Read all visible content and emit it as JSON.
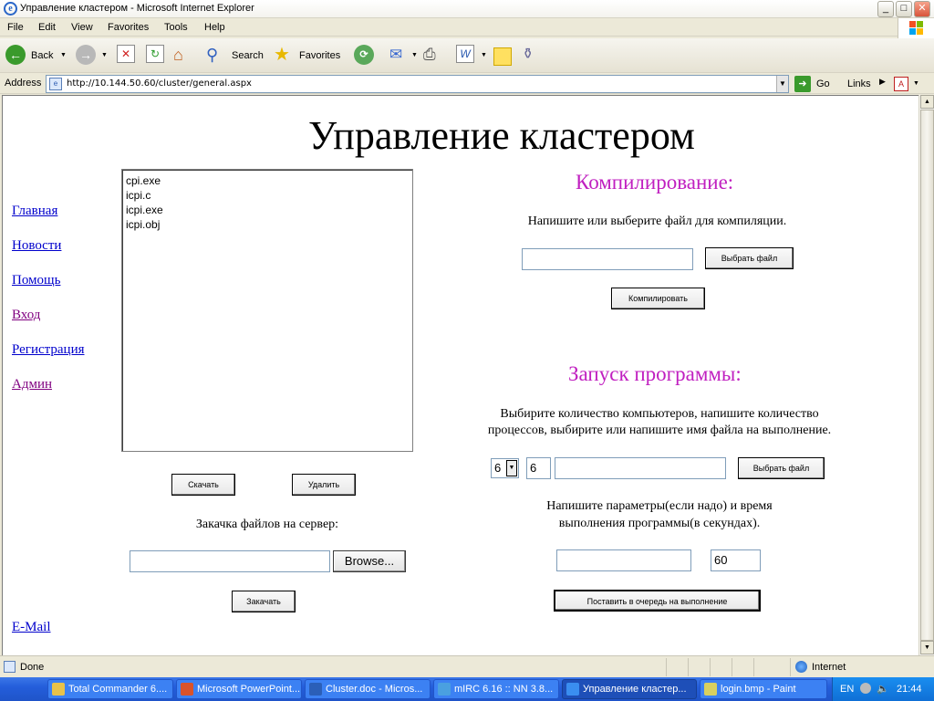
{
  "window": {
    "title": "Управление кластером - Microsoft Internet Explorer"
  },
  "menu": [
    "File",
    "Edit",
    "View",
    "Favorites",
    "Tools",
    "Help"
  ],
  "toolbar": {
    "back": "Back",
    "search": "Search",
    "favorites": "Favorites"
  },
  "address": {
    "label": "Address",
    "url": "http://10.144.50.60/cluster/general.aspx",
    "go": "Go",
    "links": "Links"
  },
  "page": {
    "title": "Управление кластером",
    "nav": [
      {
        "label": "Главная",
        "visited": false
      },
      {
        "label": "Новости",
        "visited": false
      },
      {
        "label": "Помощь",
        "visited": false
      },
      {
        "label": "Вход",
        "visited": true
      },
      {
        "label": "Регистрация",
        "visited": false
      },
      {
        "label": "Админ",
        "visited": true
      }
    ],
    "email": "E-Mail",
    "files": [
      "cpi.exe",
      "icpi.c",
      "icpi.exe",
      "icpi.obj"
    ],
    "download_btn": "Скачать",
    "delete_btn": "Удалить",
    "upload_label": "Закачка файлов на сервер:",
    "browse_btn": "Browse...",
    "upload_btn": "Закачать",
    "compile": {
      "heading": "Компилирование:",
      "instruction": "Напишите или выберите файл для компиляции.",
      "choose_btn": "Выбрать файл",
      "compile_btn": "Компилировать"
    },
    "run": {
      "heading": "Запуск программы:",
      "instruction_1": "Выбирите количество компьютеров, напишите количество",
      "instruction_2": "процессов, выбирите или напишите имя файла на выполнение.",
      "computers_selected": "6",
      "processes": "6",
      "choose_btn": "Выбрать файл",
      "params_label_1": "Напишите параметры(если надо) и время",
      "params_label_2": "выполнения программы(в секундах).",
      "time_value": "60",
      "queue_btn": "Поставить в очередь на выполнение"
    }
  },
  "status": {
    "text": "Done",
    "zone": "Internet"
  },
  "taskbar": {
    "tasks": [
      {
        "label": "Total Commander 6....",
        "color": "#e8c24a"
      },
      {
        "label": "Microsoft PowerPoint...",
        "color": "#d9532a"
      },
      {
        "label": "Cluster.doc - Micros...",
        "color": "#2b5fb8"
      },
      {
        "label": "mIRC 6.16 :: NN 3.8...",
        "color": "#4aa0e0"
      },
      {
        "label": "Управление кластер...",
        "color": "#3a8ef0"
      },
      {
        "label": "login.bmp - Paint",
        "color": "#d8d060"
      }
    ],
    "lang": "EN",
    "clock": "21:44"
  }
}
